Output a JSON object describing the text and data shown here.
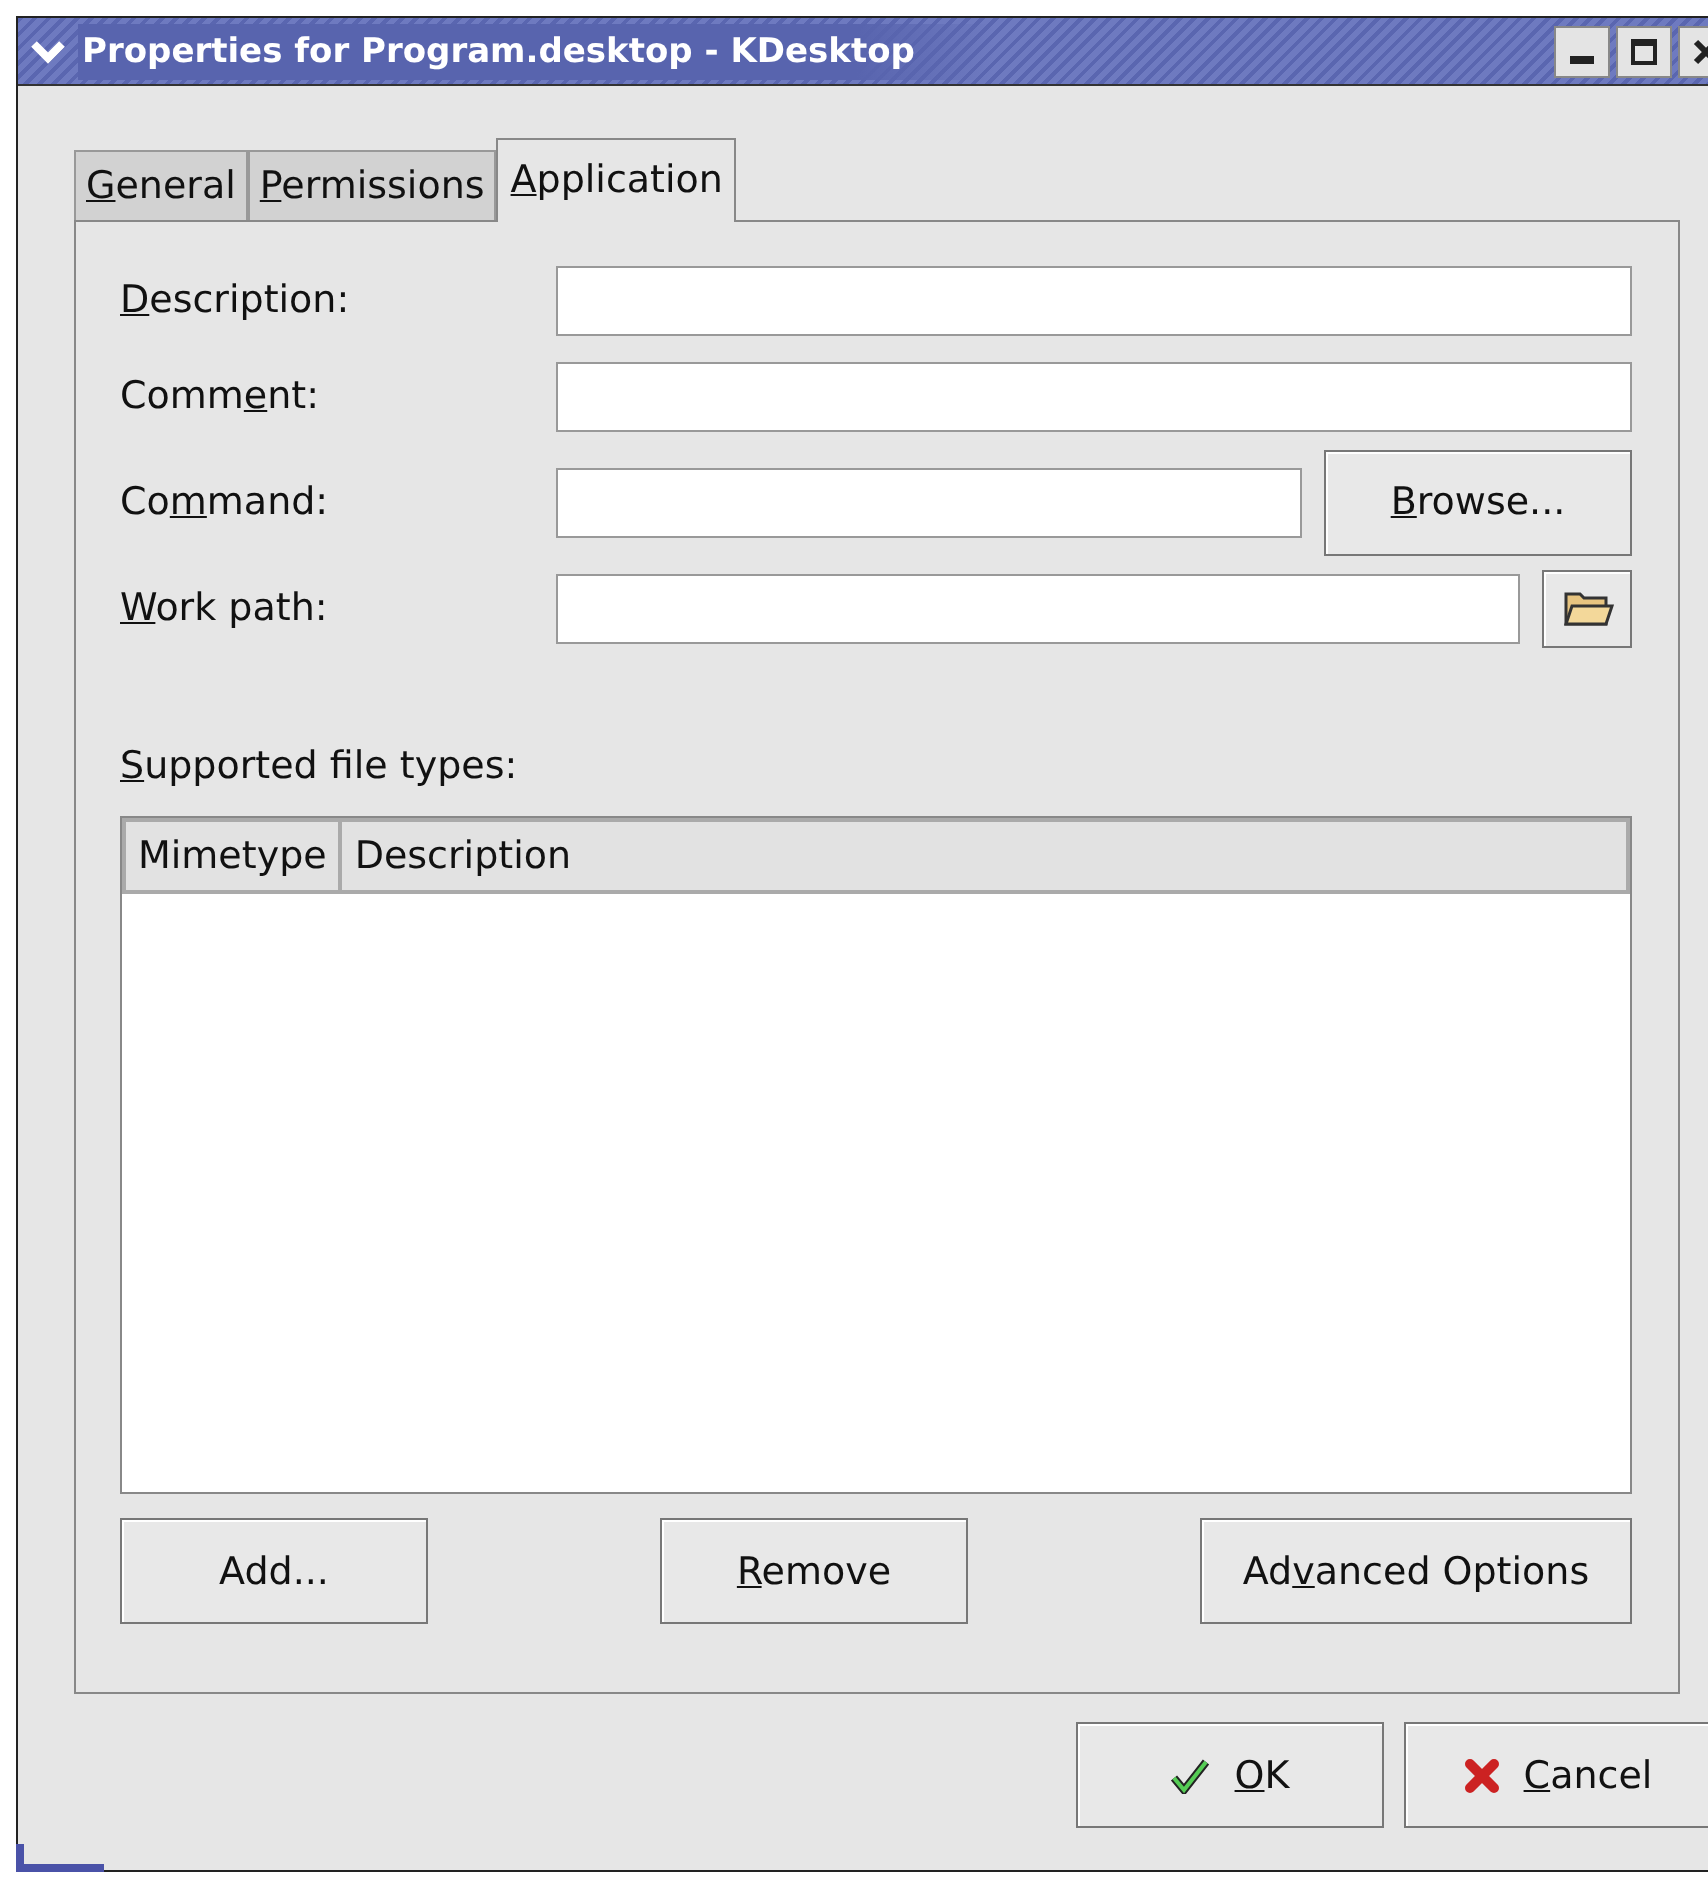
{
  "window": {
    "title": "Properties for Program.desktop - KDesktop"
  },
  "tabs": [
    {
      "label": {
        "key": "G",
        "post": "eneral"
      },
      "selected": false
    },
    {
      "label": {
        "key": "P",
        "post": "ermissions"
      },
      "selected": false
    },
    {
      "label": {
        "key": "A",
        "post": "pplication"
      },
      "selected": true
    }
  ],
  "fields": [
    {
      "kind": "plain",
      "label": {
        "key": "D",
        "post": "escription:"
      }
    },
    {
      "kind": "plain",
      "label": {
        "pre": "Comm",
        "key": "e",
        "post": "nt:"
      }
    },
    {
      "kind": "browse",
      "label": {
        "pre": "Co",
        "key": "m",
        "post": "mand:"
      },
      "button": {
        "key": "B",
        "post": "rowse..."
      }
    },
    {
      "kind": "folder",
      "label": {
        "key": "W",
        "post": "ork path:"
      }
    }
  ],
  "file_types": {
    "label": {
      "key": "S",
      "post": "upported file types:"
    },
    "columns": [
      "Mimetype",
      "Description"
    ]
  },
  "list_buttons": [
    {
      "pre": "Add..."
    },
    {
      "key": "R",
      "post": "emove"
    },
    {
      "pre": "Ad",
      "key": "v",
      "post": "anced Options"
    }
  ],
  "dialog_buttons": [
    {
      "kind": "ok",
      "label": {
        "key": "O",
        "post": "K"
      }
    },
    {
      "kind": "cancel",
      "label": {
        "key": "C",
        "post": "ancel"
      }
    }
  ]
}
